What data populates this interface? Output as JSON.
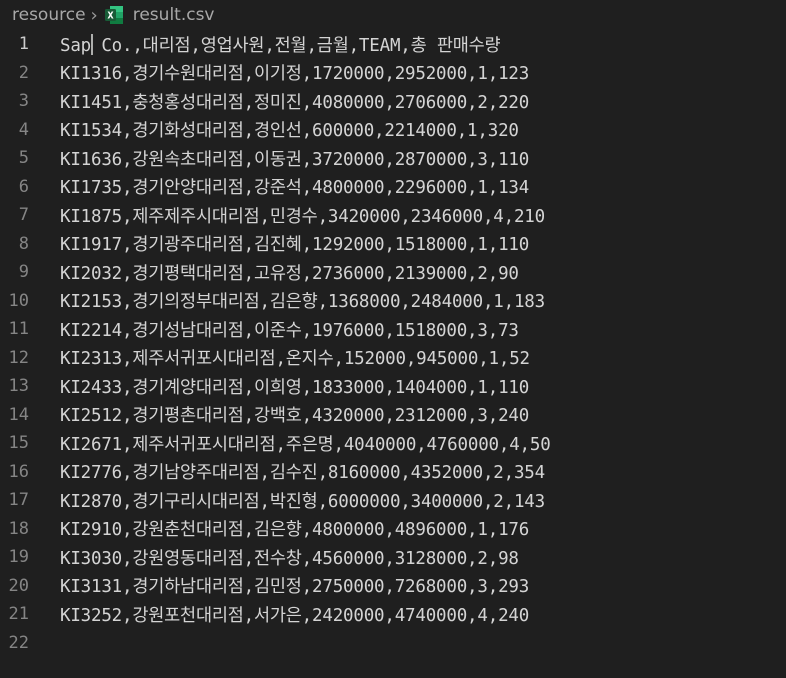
{
  "breadcrumb": {
    "folder": "resource",
    "separator": "›",
    "file": "result.csv",
    "file_icon": "excel-file-icon"
  },
  "editor": {
    "lines": [
      "Sap Co.,대리점,영업사원,전월,금월,TEAM,총 판매수량",
      "KI1316,경기수원대리점,이기정,1720000,2952000,1,123",
      "KI1451,충청홍성대리점,정미진,4080000,2706000,2,220",
      "KI1534,경기화성대리점,경인선,600000,2214000,1,320",
      "KI1636,강원속초대리점,이동권,3720000,2870000,3,110",
      "KI1735,경기안양대리점,강준석,4800000,2296000,1,134",
      "KI1875,제주제주시대리점,민경수,3420000,2346000,4,210",
      "KI1917,경기광주대리점,김진혜,1292000,1518000,1,110",
      "KI2032,경기평택대리점,고유정,2736000,2139000,2,90",
      "KI2153,경기의정부대리점,김은향,1368000,2484000,1,183",
      "KI2214,경기성남대리점,이준수,1976000,1518000,3,73",
      "KI2313,제주서귀포시대리점,온지수,152000,945000,1,52",
      "KI2433,경기계양대리점,이희영,1833000,1404000,1,110",
      "KI2512,경기평촌대리점,강백호,4320000,2312000,3,240",
      "KI2671,제주서귀포시대리점,주은명,4040000,4760000,4,50",
      "KI2776,경기남양주대리점,김수진,8160000,4352000,2,354",
      "KI2870,경기구리시대리점,박진형,6000000,3400000,2,143",
      "KI2910,강원춘천대리점,김은향,4800000,4896000,1,176",
      "KI3030,강원영동대리점,전수창,4560000,3128000,2,98",
      "KI3131,경기하남대리점,김민정,2750000,7268000,3,293",
      "KI3252,강원포천대리점,서가은,2420000,4740000,4,240",
      ""
    ],
    "line_numbers": [
      "1",
      "2",
      "3",
      "4",
      "5",
      "6",
      "7",
      "8",
      "9",
      "10",
      "11",
      "12",
      "13",
      "14",
      "15",
      "16",
      "17",
      "18",
      "19",
      "20",
      "21",
      "22"
    ],
    "current_line": 1
  },
  "colors": {
    "background": "#1f1f1f",
    "text": "#d4d4d4",
    "line_number": "#858585",
    "line_number_active": "#cccccc",
    "excel_green": "#1e7145"
  }
}
